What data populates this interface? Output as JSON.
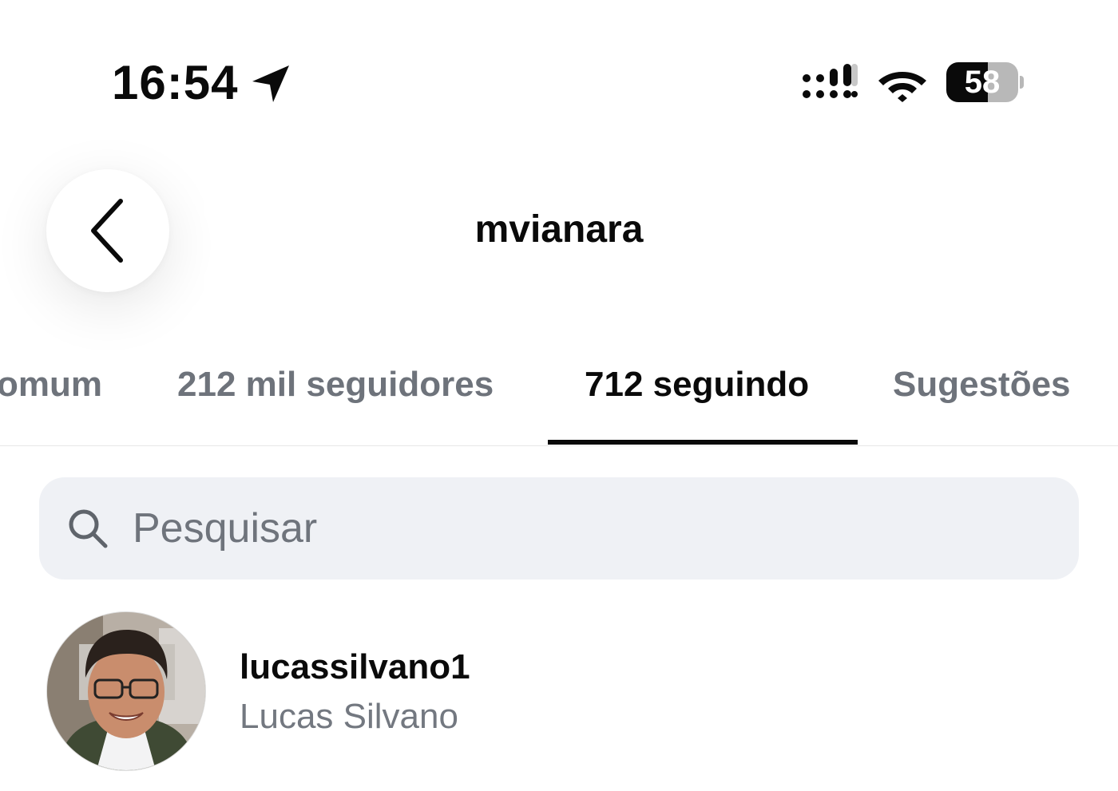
{
  "status_bar": {
    "time": "16:54",
    "battery_level": "58",
    "icons": [
      "location-arrow-icon",
      "signal-icon",
      "wifi-icon",
      "battery-icon"
    ]
  },
  "header": {
    "title": "mvianara",
    "back_icon": "chevron-left-icon"
  },
  "tabs": [
    {
      "label": "omum",
      "active": false
    },
    {
      "label": "212 mil seguidores",
      "active": false
    },
    {
      "label": "712 seguindo",
      "active": true
    },
    {
      "label": "Sugestões",
      "active": false
    }
  ],
  "search": {
    "placeholder": "Pesquisar",
    "value": "",
    "icon": "search-icon"
  },
  "accounts": [
    {
      "username": "lucassilvano1",
      "full_name": "Lucas Silvano"
    }
  ],
  "colors": {
    "text_primary": "#0a0a0a",
    "text_secondary": "#6e737b",
    "search_bg": "#eff1f5",
    "divider": "#e6e6e6"
  }
}
